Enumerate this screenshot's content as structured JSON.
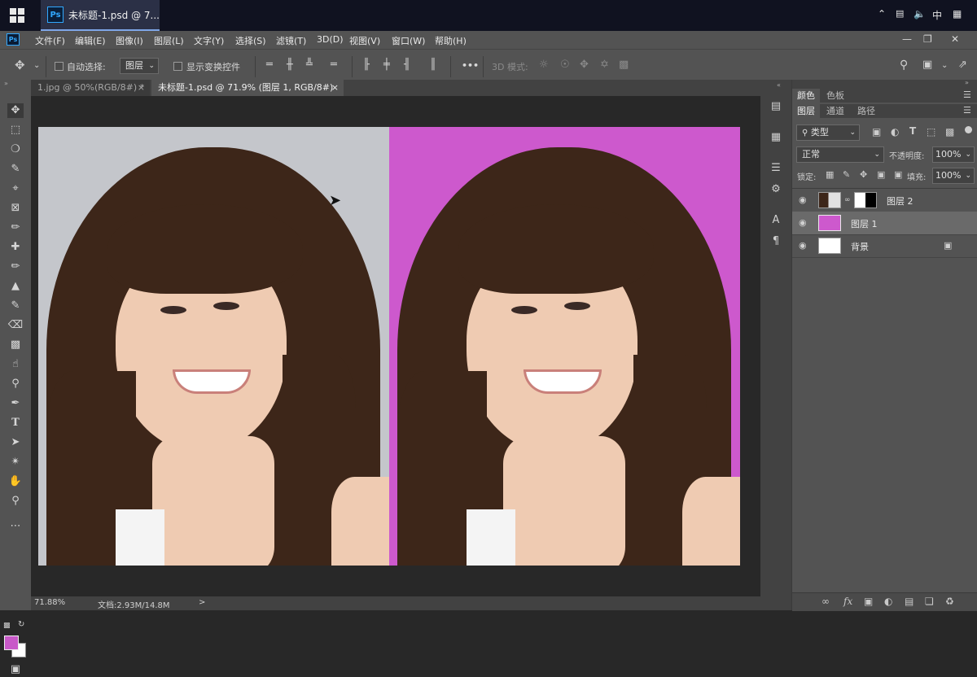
{
  "taskbar": {
    "window_title": "未标题-1.psd @ 7...",
    "app_icon": "Ps",
    "tray_ime": "中",
    "tray_icons": [
      "chevron-up-icon",
      "network-icon",
      "volume-icon",
      "ime-icon",
      "keyboard-grid-icon"
    ]
  },
  "menubar": {
    "logo": "Ps",
    "items": [
      "文件(F)",
      "编辑(E)",
      "图像(I)",
      "图层(L)",
      "文字(Y)",
      "选择(S)",
      "滤镜(T)",
      "3D(D)",
      "视图(V)",
      "窗口(W)",
      "帮助(H)"
    ]
  },
  "options": {
    "auto_select_label": "自动选择:",
    "auto_select_value": "图层",
    "show_transform_label": "显示变换控件",
    "more_label": "•••",
    "mode_3d_label": "3D 模式:"
  },
  "tabs": [
    {
      "label": "1.jpg @ 50%(RGB/8#) *",
      "active": false
    },
    {
      "label": "未标题-1.psd @ 71.9% (图层 1, RGB/8#)",
      "active": true
    }
  ],
  "tab_close": "×",
  "status": {
    "zoom": "71.88%",
    "doc_info": "文档:2.93M/14.8M",
    "arrow": ">"
  },
  "panels": {
    "top_tabs": [
      "颜色",
      "色板"
    ],
    "layer_tabs": [
      "图层",
      "通道",
      "路径"
    ],
    "filter_kind": "类型",
    "blend_mode": "正常",
    "opacity_label": "不透明度:",
    "opacity_value": "100%",
    "lock_label": "锁定:",
    "fill_label": "填充:",
    "fill_value": "100%",
    "layers": [
      {
        "name": "图层 2",
        "selected": false,
        "has_mask": true
      },
      {
        "name": "图层 1",
        "selected": true,
        "has_mask": false
      },
      {
        "name": "背景",
        "selected": false,
        "locked": true
      }
    ]
  },
  "colors": {
    "foreground": "#c859c8",
    "background": "#ffffff",
    "canvas_right_bg": "#cd59cd",
    "canvas_left_bg": "#c4c6cb"
  }
}
